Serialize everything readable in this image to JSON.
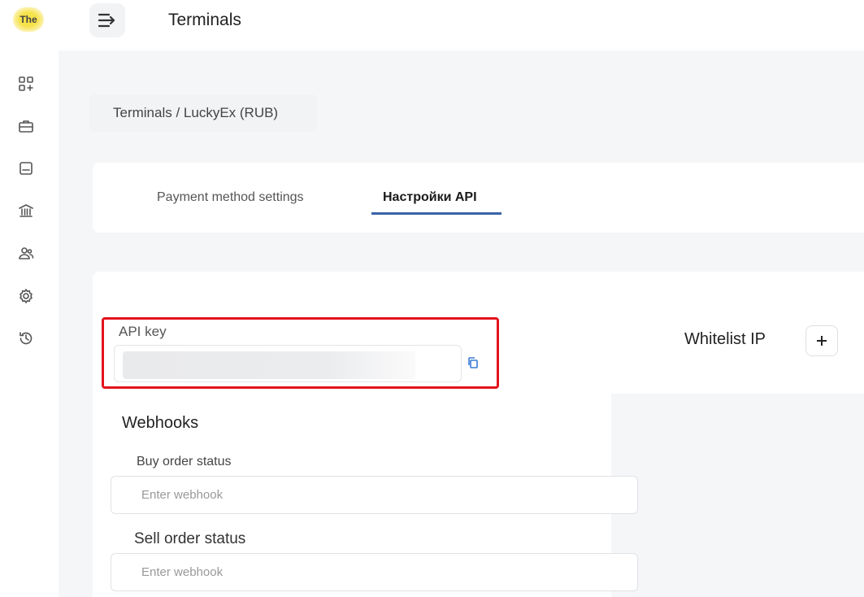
{
  "app": {
    "logo_text": "The"
  },
  "header": {
    "title": "Terminals"
  },
  "sidebar": {
    "items": [
      {
        "icon": "dashboard-icon"
      },
      {
        "icon": "briefcase-icon"
      },
      {
        "icon": "wallet-icon"
      },
      {
        "icon": "bank-icon"
      },
      {
        "icon": "users-icon"
      },
      {
        "icon": "gear-icon"
      },
      {
        "icon": "history-icon"
      }
    ]
  },
  "breadcrumb": {
    "text": "Terminals / LuckyEx (RUB)"
  },
  "tabs": [
    {
      "label": "Payment method settings",
      "active": false
    },
    {
      "label": "Настройки API",
      "active": true
    }
  ],
  "api": {
    "label": "API key"
  },
  "whitelist": {
    "label": "Whitelist IP",
    "add_symbol": "+"
  },
  "webhooks": {
    "title": "Webhooks",
    "buy": {
      "label": "Buy order status",
      "value": "",
      "placeholder": "Enter webhook"
    },
    "sell": {
      "label": "Sell order status",
      "value": "",
      "placeholder": "Enter webhook"
    }
  },
  "colors": {
    "accent": "#3a63a8",
    "highlight": "#e4131b",
    "copy_icon": "#3a7bd5",
    "logo": "#f6e24a"
  }
}
